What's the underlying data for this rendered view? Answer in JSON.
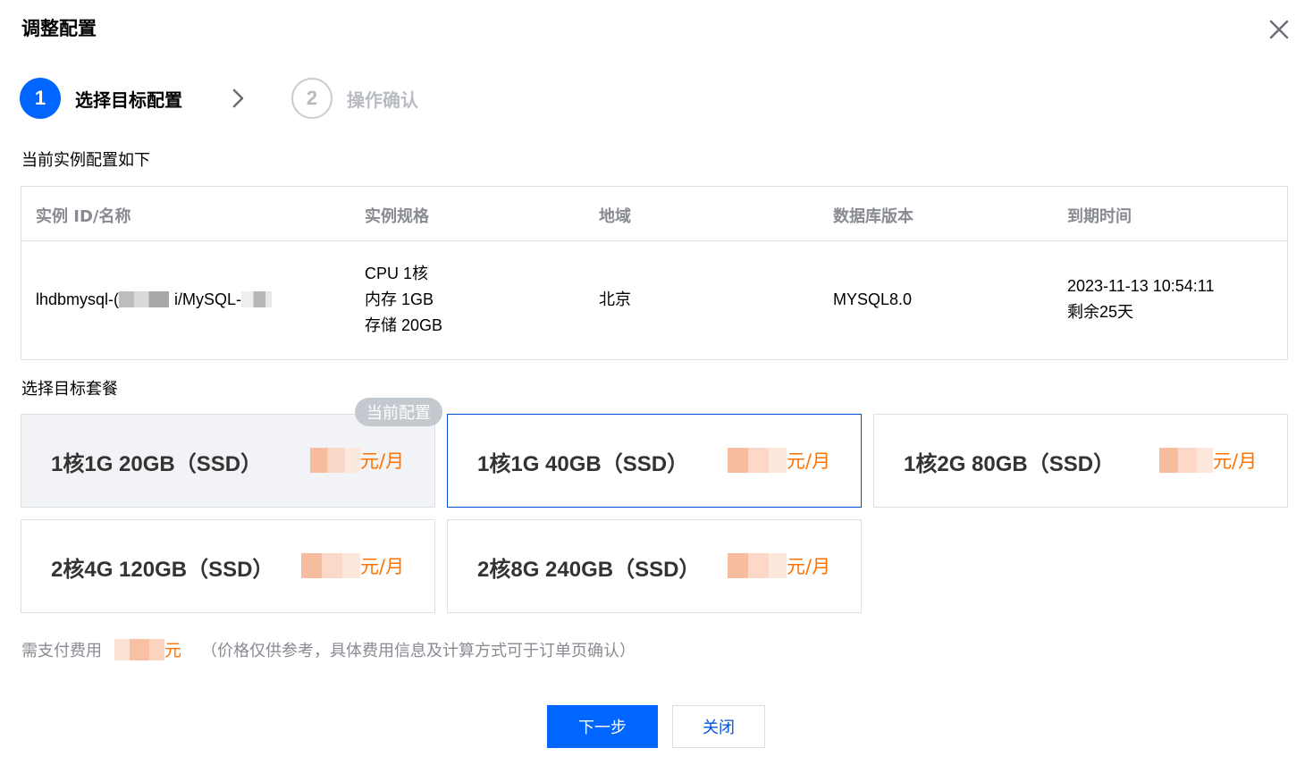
{
  "dialog": {
    "title": "调整配置"
  },
  "steps": [
    {
      "number": "1",
      "label": "选择目标配置",
      "active": true
    },
    {
      "number": "2",
      "label": "操作确认",
      "active": false
    }
  ],
  "current_section": {
    "label": "当前实例配置如下"
  },
  "instance_table": {
    "headers": [
      "实例 ID/名称",
      "实例规格",
      "地域",
      "数据库版本",
      "到期时间"
    ],
    "row": {
      "id_prefix": "lhdbmysql-(",
      "name_prefix": "i/MySQL-",
      "spec_cpu": "CPU 1核",
      "spec_memory": "内存 1GB",
      "spec_storage": "存储 20GB",
      "region": "北京",
      "db_version": "MYSQL8.0",
      "expire_time": "2023-11-13 10:54:11",
      "remaining": "剩余25天"
    }
  },
  "target_section": {
    "label": "选择目标套餐"
  },
  "current_tag": "当前配置",
  "plans": [
    {
      "name": "1核1G 20GB（SSD）",
      "price_unit": "元/月",
      "state": "current"
    },
    {
      "name": "1核1G 40GB（SSD）",
      "price_unit": "元/月",
      "state": "selected"
    },
    {
      "name": "1核2G 80GB（SSD）",
      "price_unit": "元/月",
      "state": "normal"
    },
    {
      "name": "2核4G 120GB（SSD）",
      "price_unit": "元/月",
      "state": "normal"
    },
    {
      "name": "2核8G 240GB（SSD）",
      "price_unit": "元/月",
      "state": "normal"
    }
  ],
  "fee": {
    "label": "需支付费用",
    "unit": "元",
    "note": "（价格仅供参考，具体费用信息及计算方式可于订单页确认）"
  },
  "buttons": {
    "next": "下一步",
    "close": "关闭"
  },
  "colors": {
    "primary": "#0066ff",
    "price": "#ff7200",
    "muted": "#888b92"
  }
}
